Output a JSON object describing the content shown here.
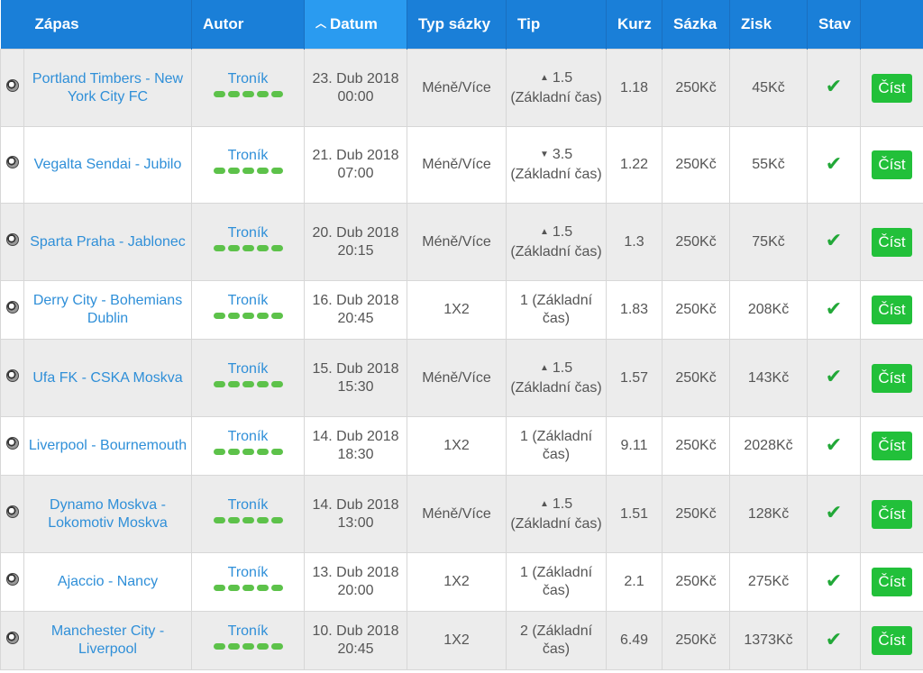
{
  "headers": {
    "match": "Zápas",
    "author": "Autor",
    "date": "Datum",
    "bet_type": "Typ sázky",
    "tip": "Tip",
    "odds": "Kurz",
    "stake": "Sázka",
    "profit": "Zisk",
    "status": "Stav"
  },
  "sort": {
    "column": "date",
    "direction": "desc"
  },
  "colors": {
    "header": "#1a7fd8",
    "sorted_header": "#2a9bf0",
    "link": "#2f8fd8",
    "win": "#22a838",
    "button": "#22c03a"
  },
  "rows": [
    {
      "match": "Portland Timbers - New York City FC",
      "author": "Troník",
      "rating": 5,
      "date": "23. Dub 2018 00:00",
      "bet_type": "Méně/Více",
      "tip_dir": "▲",
      "tip_value": "1.5",
      "tip_text": "(Základní čas)",
      "odds": "1.18",
      "stake": "250Kč",
      "profit": "45Kč",
      "status": "won",
      "status_icon": "✔",
      "button": "Číst"
    },
    {
      "match": "Vegalta Sendai - Jubilo",
      "author": "Troník",
      "rating": 5,
      "date": "21. Dub 2018 07:00",
      "bet_type": "Méně/Více",
      "tip_dir": "▼",
      "tip_value": "3.5",
      "tip_text": "(Základní čas)",
      "odds": "1.22",
      "stake": "250Kč",
      "profit": "55Kč",
      "status": "won",
      "status_icon": "✔",
      "button": "Číst"
    },
    {
      "match": "Sparta Praha - Jablonec",
      "author": "Troník",
      "rating": 5,
      "date": "20. Dub 2018 20:15",
      "bet_type": "Méně/Více",
      "tip_dir": "▲",
      "tip_value": "1.5",
      "tip_text": "(Základní čas)",
      "odds": "1.3",
      "stake": "250Kč",
      "profit": "75Kč",
      "status": "won",
      "status_icon": "✔",
      "button": "Číst"
    },
    {
      "match": "Derry City - Bohemians Dublin",
      "author": "Troník",
      "rating": 5,
      "date": "16. Dub 2018 20:45",
      "bet_type": "1X2",
      "tip_dir": "",
      "tip_value": "1",
      "tip_text": "(Základní čas)",
      "odds": "1.83",
      "stake": "250Kč",
      "profit": "208Kč",
      "status": "won",
      "status_icon": "✔",
      "button": "Číst"
    },
    {
      "match": "Ufa FK - CSKA Moskva",
      "author": "Troník",
      "rating": 5,
      "date": "15. Dub 2018 15:30",
      "bet_type": "Méně/Více",
      "tip_dir": "▲",
      "tip_value": "1.5",
      "tip_text": "(Základní čas)",
      "odds": "1.57",
      "stake": "250Kč",
      "profit": "143Kč",
      "status": "won",
      "status_icon": "✔",
      "button": "Číst"
    },
    {
      "match": "Liverpool - Bournemouth",
      "author": "Troník",
      "rating": 5,
      "date": "14. Dub 2018 18:30",
      "bet_type": "1X2",
      "tip_dir": "",
      "tip_value": "1",
      "tip_text": "(Základní čas)",
      "odds": "9.11",
      "stake": "250Kč",
      "profit": "2028Kč",
      "status": "won",
      "status_icon": "✔",
      "button": "Číst"
    },
    {
      "match": "Dynamo Moskva - Lokomotiv Moskva",
      "author": "Troník",
      "rating": 5,
      "date": "14. Dub 2018 13:00",
      "bet_type": "Méně/Více",
      "tip_dir": "▲",
      "tip_value": "1.5",
      "tip_text": "(Základní čas)",
      "odds": "1.51",
      "stake": "250Kč",
      "profit": "128Kč",
      "status": "won",
      "status_icon": "✔",
      "button": "Číst"
    },
    {
      "match": "Ajaccio - Nancy",
      "author": "Troník",
      "rating": 5,
      "date": "13. Dub 2018 20:00",
      "bet_type": "1X2",
      "tip_dir": "",
      "tip_value": "1",
      "tip_text": "(Základní čas)",
      "odds": "2.1",
      "stake": "250Kč",
      "profit": "275Kč",
      "status": "won",
      "status_icon": "✔",
      "button": "Číst"
    },
    {
      "match": "Manchester City - Liverpool",
      "author": "Troník",
      "rating": 5,
      "date": "10. Dub 2018 20:45",
      "bet_type": "1X2",
      "tip_dir": "",
      "tip_value": "2",
      "tip_text": "(Základní čas)",
      "odds": "6.49",
      "stake": "250Kč",
      "profit": "1373Kč",
      "status": "won",
      "status_icon": "✔",
      "button": "Číst"
    }
  ]
}
